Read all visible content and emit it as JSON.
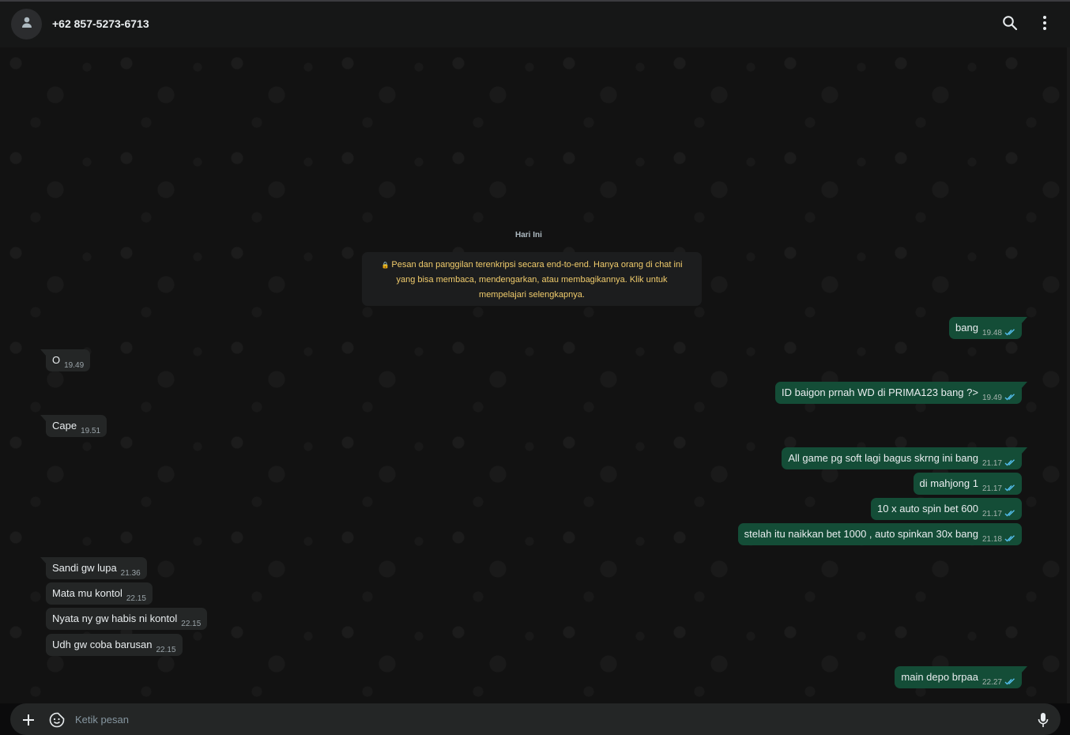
{
  "header": {
    "contact_name": "+62 857-5273-6713",
    "icons": {
      "avatar": "person-icon",
      "search": "search-icon",
      "menu": "kebab-menu-icon"
    }
  },
  "chat": {
    "date_label": "Hari Ini",
    "encryption_notice": {
      "line1": "Pesan dan panggilan terenkripsi secara end-to-end. Hanya orang di chat ini",
      "line2": "yang bisa membaca, mendengarkan, atau membagikannya. Klik untuk",
      "line3": "mempelajari selengkapnya."
    },
    "messages": [
      {
        "direction": "out",
        "text": "bang",
        "time": "19.48",
        "read": true
      },
      {
        "direction": "in",
        "text": "O",
        "time": "19.49"
      },
      {
        "direction": "out",
        "text": "ID baigon prnah WD di PRIMA123 bang ?>",
        "time": "19.49",
        "read": true
      },
      {
        "direction": "in",
        "text": "Cape",
        "time": "19.51"
      },
      {
        "direction": "out",
        "text": "All game pg soft lagi bagus skrng ini bang",
        "time": "21.17",
        "read": true
      },
      {
        "direction": "out",
        "text": "di mahjong 1",
        "time": "21.17",
        "read": true
      },
      {
        "direction": "out",
        "text": "10 x auto spin bet 600",
        "time": "21.17",
        "read": true
      },
      {
        "direction": "out",
        "text": "stelah itu naikkan bet 1000 , auto spinkan 30x bang",
        "time": "21.18",
        "read": true
      },
      {
        "direction": "in",
        "text": "Sandi gw lupa",
        "time": "21.36"
      },
      {
        "direction": "in",
        "text": "Mata mu kontol",
        "time": "22.15"
      },
      {
        "direction": "in",
        "text": "Nyata ny gw habis ni kontol",
        "time": "22.15"
      },
      {
        "direction": "in",
        "text": "Udh gw coba barusan",
        "time": "22.15"
      },
      {
        "direction": "out",
        "text": "main depo brpaa",
        "time": "22.27",
        "read": true
      }
    ]
  },
  "composer": {
    "placeholder": "Ketik pesan",
    "icons": {
      "attach": "plus-icon",
      "sticker": "sticker-icon",
      "voice": "microphone-icon"
    }
  },
  "colors": {
    "header_bg": "#161717",
    "chat_bg": "#121212",
    "incoming_bubble": "#242626",
    "outgoing_bubble": "#144d37",
    "read_ticks": "#53bdeb",
    "notice_text": "#f1cc6c"
  }
}
